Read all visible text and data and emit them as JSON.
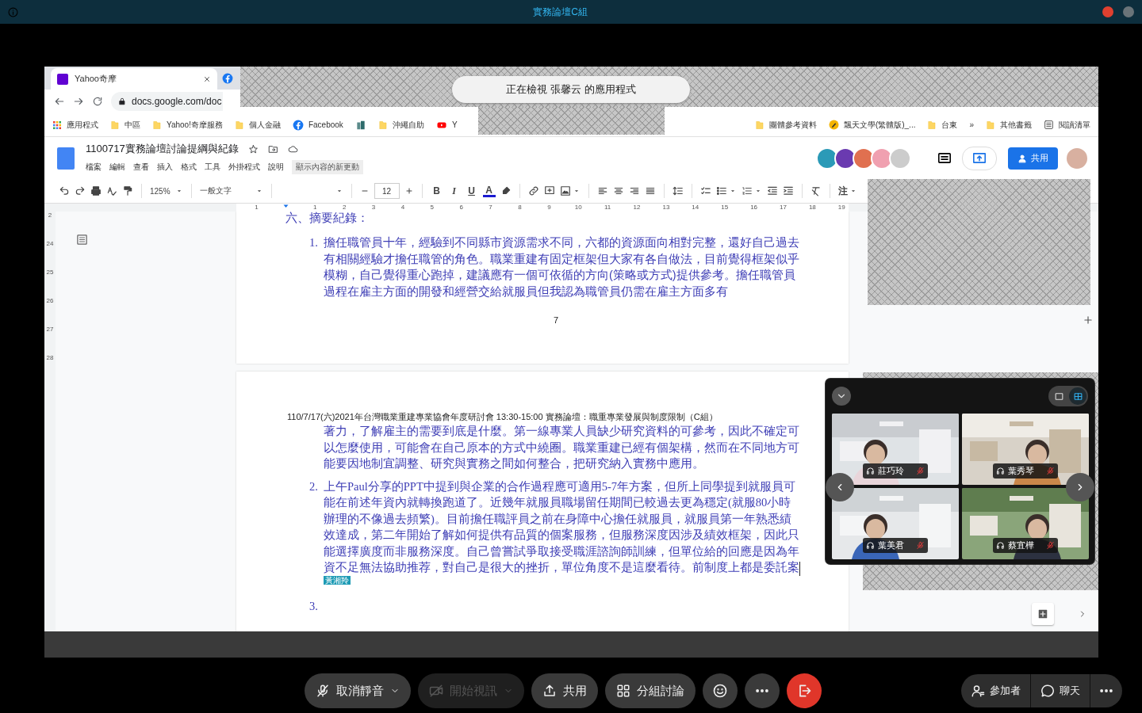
{
  "meeting": {
    "title": "實務論壇C組"
  },
  "banner": "正在檢視 張馨云 的應用程式",
  "browser": {
    "tab": {
      "title": "Yahoo奇摩"
    },
    "url": "docs.google.com/doc",
    "bookmarks_left": [
      {
        "kind": "apps",
        "label": "應用程式"
      },
      {
        "kind": "folder",
        "label": "中區"
      },
      {
        "kind": "folder",
        "label": "Yahoo!奇摩服務"
      },
      {
        "kind": "folder",
        "label": "個人金融"
      },
      {
        "kind": "facebook",
        "label": "Facebook"
      },
      {
        "kind": "site"
      },
      {
        "kind": "folder",
        "label": "沖繩自助"
      },
      {
        "kind": "video",
        "label": "Y"
      }
    ],
    "bookmarks_right": [
      {
        "kind": "folder",
        "label": "團體參考資料"
      },
      {
        "kind": "pen",
        "label": "飄天文學(繁體版)_..."
      },
      {
        "kind": "folder",
        "label": "台東"
      },
      {
        "kind": "more",
        "label": "»"
      },
      {
        "kind": "folder",
        "label": "其他書籤"
      },
      {
        "kind": "list",
        "label": "閱讀清單"
      }
    ]
  },
  "docs": {
    "title": "1100717實務論壇討論提綱與紀錄",
    "menu": [
      "檔案",
      "編輯",
      "查看",
      "插入",
      "格式",
      "工具",
      "外掛程式",
      "說明"
    ],
    "update_notice": "顯示內容的新更動",
    "share": "共用",
    "zoom": "125%",
    "style": "一般文字",
    "font_size": "12",
    "format_letters": [
      "B",
      "I",
      "U",
      "A"
    ],
    "input_tools": "注",
    "ruler": [
      "1",
      "1",
      "2",
      "3",
      "4",
      "5",
      "6",
      "7",
      "8",
      "9",
      "10",
      "11",
      "12",
      "13",
      "14",
      "15",
      "16",
      "17",
      "18",
      "19"
    ],
    "side_ruler": [
      "2",
      "24",
      "25",
      "26",
      "27",
      "28"
    ]
  },
  "page_1": {
    "heading": "六、摘要紀錄：",
    "items": [
      {
        "number": "1.",
        "text": "擔任職管員十年，經驗到不同縣市資源需求不同，六都的資源面向相對完整，還好自己過去有相關經驗才擔任職管的角色。職業重建有固定框架但大家有各自做法，目前覺得框架似乎模糊，自己覺得重心跑掉，建議應有一個可依循的方向(策略或方式)提供參考。擔任職管員過程在雇主方面的開發和經營交給就服員但我認為職管員仍需在雇主方面多有"
      }
    ],
    "page_number": "7"
  },
  "page_2": {
    "header": "110/7/17(六)2021年台灣職業重建專業協會年度研討會 13:30-15:00 實務論壇：職重專業發展與制度限制（C組）",
    "continuation": "著力，了解雇主的需要到底是什麼。第一線專業人員缺少研究資料的可參考，因此不確定可以怎麼使用，可能會在自己原本的方式中繞圈。職業重建已經有個架構，然而在不同地方可能要因地制宜調整、研究與實務之間如何整合，把研究納入實務中應用。",
    "items": [
      {
        "number": "2.",
        "text": "上午Paul分享的PPT中提到與企業的合作過程應可適用5-7年方案，但所上同學提到就服員可能在前述年資內就轉換跑道了。近幾年就服員職場留任期間已較過去更為穩定(就服80小時辦理的不像過去頻繁)。目前擔任職評員之前在身障中心擔任就服員，就服員第一年熟悉績效達成，第二年開始了解如何提供有品質的個案服務，但服務深度因涉及績效框架，因此只能選擇廣度而非服務深度。自己曾嘗試爭取接受職涯諮詢師訓練，但單位給的回應是因為年資不足無法協助推荐，對自己是很大的挫折，單位角度不是這麼看待。前制度上都是委託案",
        "cursor_label": "黃湘羚"
      },
      {
        "number": "3."
      }
    ]
  },
  "video_panel": {
    "view_modes": [
      {
        "selected": false
      },
      {
        "selected": true
      }
    ],
    "participants": [
      {
        "name": "莊巧玲",
        "muted": true
      },
      {
        "name": "葉秀琴",
        "muted": true
      },
      {
        "name": "葉美君",
        "muted": true
      },
      {
        "name": "蔡宜樺",
        "muted": true
      }
    ]
  },
  "toolbar": {
    "left": [
      {
        "kind": "mute",
        "label": "取消靜音",
        "dropdown": true,
        "disabled": false
      },
      {
        "kind": "video",
        "label": "開始視訊",
        "dropdown": true,
        "disabled": true
      },
      {
        "kind": "share",
        "label": "共用",
        "dropdown": false,
        "disabled": false
      },
      {
        "kind": "breakout",
        "label": "分組討論",
        "dropdown": false,
        "disabled": false
      },
      {
        "kind": "reaction"
      },
      {
        "kind": "more"
      },
      {
        "kind": "leave"
      }
    ],
    "right": [
      {
        "kind": "participants",
        "label": "參加者"
      },
      {
        "kind": "chat",
        "label": "聊天"
      },
      {
        "kind": "more"
      }
    ]
  }
}
